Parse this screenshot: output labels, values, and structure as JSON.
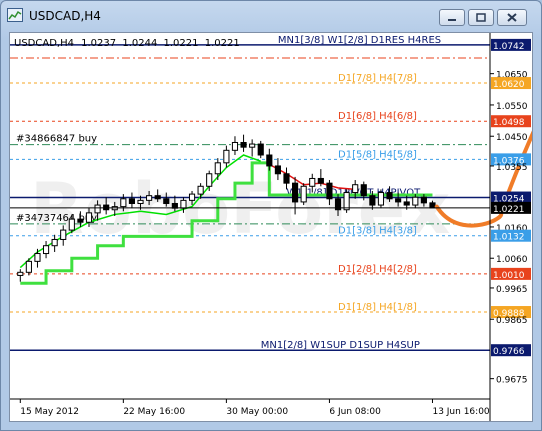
{
  "window": {
    "title": "USDCAD,H4",
    "buttons": {
      "minimize": "minimize-icon",
      "restore": "restore-icon",
      "close": "close-icon"
    }
  },
  "chart_header": {
    "symbol": "USDCAD,H4",
    "open": "1.0237",
    "high": "1.0244",
    "low": "1.0221",
    "close": "1.0221"
  },
  "chart_data": {
    "type": "candlestick",
    "symbol": "USDCAD",
    "timeframe": "H4",
    "ylim": [
      0.961,
      1.078
    ],
    "yticks": [
      {
        "value": 1.0742,
        "label": "1.0742",
        "boxed": true,
        "color": "#0b1a6e"
      },
      {
        "value": 1.065,
        "label": "1.0650"
      },
      {
        "value": 1.062,
        "label": "1.0620",
        "boxed": true,
        "color": "#f5a623"
      },
      {
        "value": 1.055,
        "label": "1.0550"
      },
      {
        "value": 1.0498,
        "label": "1.0498",
        "boxed": true,
        "color": "#e8431c"
      },
      {
        "value": 1.045,
        "label": "1.0450"
      },
      {
        "value": 1.0376,
        "label": "1.0376",
        "boxed": true,
        "color": "#3a9ee8"
      },
      {
        "value": 1.0355,
        "label": "1.0355"
      },
      {
        "value": 1.0254,
        "label": "1.0254",
        "boxed": true,
        "color": "#0b1a6e"
      },
      {
        "value": 1.0221,
        "label": "1.0221",
        "boxed": true,
        "color": "#000000"
      },
      {
        "value": 1.016,
        "label": "1.0160"
      },
      {
        "value": 1.0132,
        "label": "1.0132",
        "boxed": true,
        "color": "#3a9ee8"
      },
      {
        "value": 1.006,
        "label": "1.0060"
      },
      {
        "value": 1.001,
        "label": "1.0010",
        "boxed": true,
        "color": "#e8431c"
      },
      {
        "value": 0.9965,
        "label": "0.9965"
      },
      {
        "value": 0.9888,
        "label": "0.9888",
        "boxed": true,
        "color": "#f5a623"
      },
      {
        "value": 0.9865,
        "label": "0.9865"
      },
      {
        "value": 0.9766,
        "label": "0.9766",
        "boxed": true,
        "color": "#0b1a6e"
      },
      {
        "value": 0.9675,
        "label": "0.9675"
      }
    ],
    "xticks": [
      {
        "x": 0.0,
        "label": "15 May 2012"
      },
      {
        "x": 12.0,
        "label": "22 May 16:00"
      },
      {
        "x": 24.0,
        "label": "30 May 00:00"
      },
      {
        "x": 36.0,
        "label": "6 Jun 08:00"
      },
      {
        "x": 48.0,
        "label": "13 Jun 16:00"
      }
    ],
    "levels": [
      {
        "value": 1.0742,
        "label": "MN1[3/8] W1[2/8] D1RES H4RES",
        "color": "#0b1a6e",
        "style": "solid",
        "label_x": 30.0
      },
      {
        "value": 1.07,
        "label": "",
        "color": "#e8431c",
        "style": "dashdot",
        "label_x": 0
      },
      {
        "value": 1.062,
        "label": "D1[7/8] H4[7/8]",
        "color": "#f5a623",
        "style": "dotted",
        "label_x": 37.0
      },
      {
        "value": 1.0498,
        "label": "D1[6/8] H4[6/8]",
        "color": "#e8431c",
        "style": "dotted",
        "label_x": 37.0
      },
      {
        "value": 1.0376,
        "label": "D1[5/8] H4[5/8]",
        "color": "#3a9ee8",
        "style": "dotted",
        "label_x": 37.0
      },
      {
        "value": 1.0254,
        "label": "W1[1/8] D1PIVOT H4PIVOT",
        "color": "#0b1a6e",
        "style": "solid",
        "label_x": 31.0
      },
      {
        "value": 1.0132,
        "label": "D1[3/8] H4[3/8]",
        "color": "#3a9ee8",
        "style": "dotted",
        "label_x": 37.0
      },
      {
        "value": 1.001,
        "label": "D1[2/8] H4[2/8]",
        "color": "#e8431c",
        "style": "dotted",
        "label_x": 37.0
      },
      {
        "value": 0.9888,
        "label": "D1[1/8] H4[1/8]",
        "color": "#f5a623",
        "style": "dotted",
        "label_x": 37.0
      },
      {
        "value": 0.9766,
        "label": "MN1[2/8] W1SUP D1SUP H4SUP",
        "color": "#0b1a6e",
        "style": "solid",
        "label_x": 28.0
      }
    ],
    "orders": [
      {
        "value": 1.0423,
        "label": "#34866847 buy",
        "color": "#2e8b57"
      },
      {
        "value": 1.017,
        "label": "#34737464 buy",
        "color": "#2e8b57"
      }
    ],
    "current_price": {
      "value": 1.0221
    },
    "candles": [
      [
        0,
        1.0005,
        1.0025,
        0.9985,
        1.0015
      ],
      [
        1,
        1.0015,
        1.006,
        1.0005,
        1.005
      ],
      [
        2,
        1.005,
        1.009,
        1.003,
        1.0075
      ],
      [
        3,
        1.0075,
        1.0115,
        1.006,
        1.01
      ],
      [
        4,
        1.01,
        1.0135,
        1.008,
        1.012
      ],
      [
        5,
        1.012,
        1.0165,
        1.01,
        1.015
      ],
      [
        6,
        1.015,
        1.02,
        1.014,
        1.0185
      ],
      [
        7,
        1.0185,
        1.021,
        1.016,
        1.0175
      ],
      [
        8,
        1.0175,
        1.022,
        1.016,
        1.0205
      ],
      [
        9,
        1.0205,
        1.0245,
        1.018,
        1.023
      ],
      [
        10,
        1.023,
        1.0255,
        1.02,
        1.0215
      ],
      [
        11,
        1.0215,
        1.024,
        1.0195,
        1.0225
      ],
      [
        12,
        1.0225,
        1.0265,
        1.021,
        1.025
      ],
      [
        13,
        1.025,
        1.027,
        1.022,
        1.0235
      ],
      [
        14,
        1.0235,
        1.026,
        1.0215,
        1.0245
      ],
      [
        15,
        1.0245,
        1.0275,
        1.023,
        1.026
      ],
      [
        16,
        1.026,
        1.028,
        1.024,
        1.025
      ],
      [
        17,
        1.025,
        1.027,
        1.0225,
        1.0235
      ],
      [
        18,
        1.0235,
        1.026,
        1.021,
        1.022
      ],
      [
        19,
        1.022,
        1.0255,
        1.0205,
        1.0245
      ],
      [
        20,
        1.0245,
        1.0275,
        1.023,
        1.0265
      ],
      [
        21,
        1.0265,
        1.03,
        1.025,
        1.029
      ],
      [
        22,
        1.029,
        1.034,
        1.0275,
        1.033
      ],
      [
        23,
        1.033,
        1.038,
        1.031,
        1.0365
      ],
      [
        24,
        1.0365,
        1.042,
        1.035,
        1.0405
      ],
      [
        25,
        1.0405,
        1.045,
        1.039,
        1.043
      ],
      [
        26,
        1.043,
        1.0455,
        1.04,
        1.0415
      ],
      [
        27,
        1.0415,
        1.044,
        1.0385,
        1.0425
      ],
      [
        28,
        1.0425,
        1.0435,
        1.038,
        1.039
      ],
      [
        29,
        1.039,
        1.041,
        1.034,
        1.0355
      ],
      [
        30,
        1.0355,
        1.038,
        1.031,
        1.033
      ],
      [
        31,
        1.033,
        1.035,
        1.028,
        1.03
      ],
      [
        32,
        1.03,
        1.032,
        1.02,
        1.024
      ],
      [
        33,
        1.024,
        1.03,
        1.023,
        1.029
      ],
      [
        34,
        1.029,
        1.033,
        1.027,
        1.0315
      ],
      [
        35,
        1.0315,
        1.0345,
        1.029,
        1.03
      ],
      [
        36,
        1.03,
        1.031,
        1.023,
        1.025
      ],
      [
        37,
        1.025,
        1.0265,
        1.0195,
        1.0215
      ],
      [
        38,
        1.0215,
        1.028,
        1.0205,
        1.027
      ],
      [
        39,
        1.027,
        1.031,
        1.025,
        1.0295
      ],
      [
        40,
        1.0295,
        1.0305,
        1.0245,
        1.026
      ],
      [
        41,
        1.026,
        1.0275,
        1.0215,
        1.023
      ],
      [
        42,
        1.023,
        1.028,
        1.022,
        1.027
      ],
      [
        43,
        1.027,
        1.029,
        1.024,
        1.025
      ],
      [
        44,
        1.025,
        1.027,
        1.0225,
        1.024
      ],
      [
        45,
        1.024,
        1.026,
        1.0215,
        1.023
      ],
      [
        46,
        1.023,
        1.0265,
        1.022,
        1.0255
      ],
      [
        47,
        1.0255,
        1.0265,
        1.0225,
        1.0237
      ],
      [
        48,
        1.0237,
        1.0244,
        1.0221,
        1.0221
      ]
    ],
    "x_range": [
      -0.5,
      54.0
    ],
    "forecast_arrow": {
      "color": "#f07c28",
      "points": [
        [
          48.5,
          1.0225
        ],
        [
          51.0,
          1.015
        ],
        [
          56.0,
          1.02
        ],
        [
          60.0,
          1.05
        ],
        [
          63.5,
          1.069
        ]
      ]
    },
    "trend_steps_green": [
      [
        0,
        0.998
      ],
      [
        3,
        0.998
      ],
      [
        3,
        1.002
      ],
      [
        6,
        1.002
      ],
      [
        6,
        1.006
      ],
      [
        9,
        1.006
      ],
      [
        9,
        1.01
      ],
      [
        12,
        1.01
      ],
      [
        12,
        1.013
      ],
      [
        20,
        1.013
      ],
      [
        20,
        1.018
      ],
      [
        23,
        1.018
      ],
      [
        23,
        1.025
      ],
      [
        25,
        1.025
      ],
      [
        25,
        1.03
      ],
      [
        27,
        1.03
      ],
      [
        27,
        1.0365
      ],
      [
        29,
        1.0365
      ],
      [
        29,
        1.0262
      ],
      [
        48,
        1.0262
      ]
    ],
    "trend_steps_green_bright": [
      [
        0,
        1.003
      ],
      [
        2,
        1.008
      ],
      [
        5,
        1.013
      ],
      [
        8,
        1.0175
      ],
      [
        11,
        1.02
      ],
      [
        14,
        1.021
      ],
      [
        17,
        1.02
      ],
      [
        20,
        1.0225
      ],
      [
        22,
        1.029
      ],
      [
        24,
        1.035
      ],
      [
        26,
        1.039
      ],
      [
        28,
        1.037
      ]
    ],
    "trend_red": [
      [
        29,
        1.036
      ],
      [
        31,
        1.033
      ],
      [
        33,
        1.0295
      ],
      [
        35,
        1.03
      ],
      [
        37,
        1.0285
      ],
      [
        39,
        1.028
      ]
    ]
  }
}
